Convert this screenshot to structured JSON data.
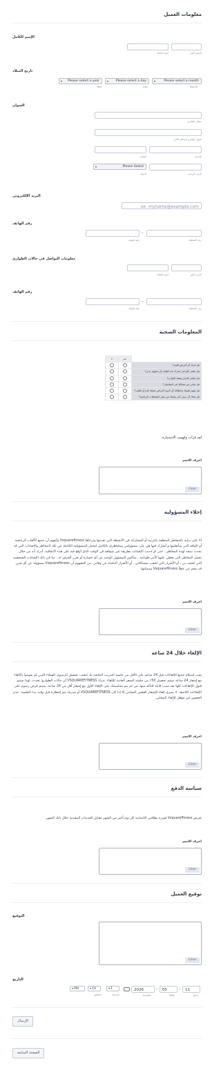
{
  "client_info": {
    "title": "معلومات العميل",
    "full_name": {
      "label": "الإسم الكامل",
      "first": "الإسم الأول",
      "last": "اسم العائلة"
    },
    "birth_date": {
      "label": "تاريخ الميلاد",
      "month": "Please select a month",
      "day": "Please select a day",
      "year": "Please select a year",
      "month_sub": "Month",
      "day_sub": "Day",
      "year_sub": "Year"
    },
    "address": {
      "label": "العنوان",
      "street1": "عنوان الشارع",
      "street2": "عنوان الشارع السطر الثاني",
      "city": "المدينة",
      "state": "الولاية",
      "zip": "الرمز البريدي",
      "country_select": "Please Select",
      "country": "الدولة"
    },
    "email": {
      "label": "البريد الإلكتروني",
      "placeholder": "ex: myname@example.com"
    },
    "phone": {
      "label": "رقم الهاتف",
      "area": "رمز المنطقة",
      "number": "رقم الهاتف",
      "dash": "-"
    },
    "emergency": {
      "label": "معلومات التواصل في حالات الطوارئ",
      "first": "الإسم الأول",
      "last": "اسم العائلة"
    },
    "phone2": {
      "label": "رقم الهاتف",
      "area": "رمز المنطقة",
      "number": "رقم الهاتف",
      "dash": "-"
    }
  },
  "health": {
    "title": "المعلومات الصحية",
    "cols": [
      "نعم",
      "لا"
    ],
    "questions": [
      "هل لديك أي أمراض قلبية؟",
      "هل تشعر بألم في صدرك عند القيام بأي مجهود بدني؟",
      "هل تشعر بالدوار وتفقد التوازن؟",
      "هل تعاني من مشاكل في المفاصل؟",
      "هل يقوم طبيبك بإعطائك أي أدوية لأمراض ضغط الدم أو القلب؟",
      "هل هناك أي سبب آخر يمنعك من عمل النشاطات الرياضية؟"
    ],
    "ack": "لقد قرأت وفهمت الاستمارة.",
    "sig_label": "احرف الاسم",
    "clear": "Clear"
  },
  "liability": {
    "title": "إخلاء المسؤولية",
    "text": "أنا على دراية بالمخاطر المتعلقة بالتربية أو المشاركة في الأنشطة التي تقدمها وترعاها Vsquarefitness وأتفهم أن جميع الألعاب الرياضية أو اللياقة التي سأتعلمها و أشارك فيها هي على مسؤوليتي ومخاطري بالكامل لتحمل المسؤولية الكاملة عن تلك المخاطر والإصابات التي قد تحدث نتيجة لهذه المخاطر ، حتى لو حدثت الإصابات بطريقة غير متوقعة في الوقت الذي أوقع فيه على هذه الاتفاقية. أدرك أنه من خلال تحمل المخاطر التي يغطي عليها الأمر طواعية ، سأكون المسؤول الوحيد عن أي خسارة أو ضرر أتعرض له ، بما في ذلك الإصابات الشخصية التي لحقت بي ، أو الأضرار التي لحقت بممتلكاتي ، أو الأضرار الناشئة عن وفاتي. من المفهوم أن Vsquarefitness مسؤولة عن أي ضرر قد ينجم عن خطأ Vsquarefitness وممثليها.",
    "sig_label": "احرف الاسم",
    "clear": "Clear"
  },
  "cancel": {
    "title": "الإلغاء خلال 24 ساعة",
    "text": "يجب استلام جميع الإلغاءات قبل 24 ساعة على الأقل من جلسة التدريب الخاصة بك لتجنب تحصيل الرسوم. العملاء الذين لم يقوموا بالإلغاء مع إشعار 24 ساعة سيتم تحصيل 50٪ من جلسة السعر العادية للإلغاء. ندرك VSQUAREFITNESS أن حالات الطوارئ تحدث، لهذا ستتم قبول الإلغاءات كلها بعد سبب قابلة للتأكد منها. من لم يتم محاسبتك على الإلغاء الأول مع إشعار أقل من 24 ساعة. سيتم فرض رسوم على الإلغاءات اللاحقة. لا يسري إلغاء الإشعار القصير المجاني إلا إذا كان VSQUAREFITNESS أو مدربك يتم إخطاره قبل وقت بدء الجلسة. عدم الحضور غير مؤهل للإلغاء المجاني.",
    "sig_label": "احرف الاسم",
    "clear": "Clear"
  },
  "payment": {
    "title": "سياسة الدفع",
    "text": "تفرض Vsquarefitness فوترة بطاقتي الائتمانية كل يوم أخير من الشهر مقابل الخدمات المقدمة خلال ذلك الشهر.",
    "sig_label": "احرف الاسم",
    "clear": "Clear"
  },
  "client_signature": {
    "title": "توقيع العميل",
    "sig_label": "التوقيع",
    "clear": "Clear",
    "date_label": "التاريخ",
    "day": "11",
    "month": "05",
    "year": "2026",
    "day_sub": "Jour",
    "month_sub": "Mois",
    "year_sub": "Année",
    "hour": "1",
    "minute": "10",
    "ampm": "PM",
    "hour_sub": "الساعة",
    "minute_sub": "الدقائق"
  },
  "buttons": {
    "submit": "الإرسال",
    "back": "الصفحة السابقة"
  }
}
